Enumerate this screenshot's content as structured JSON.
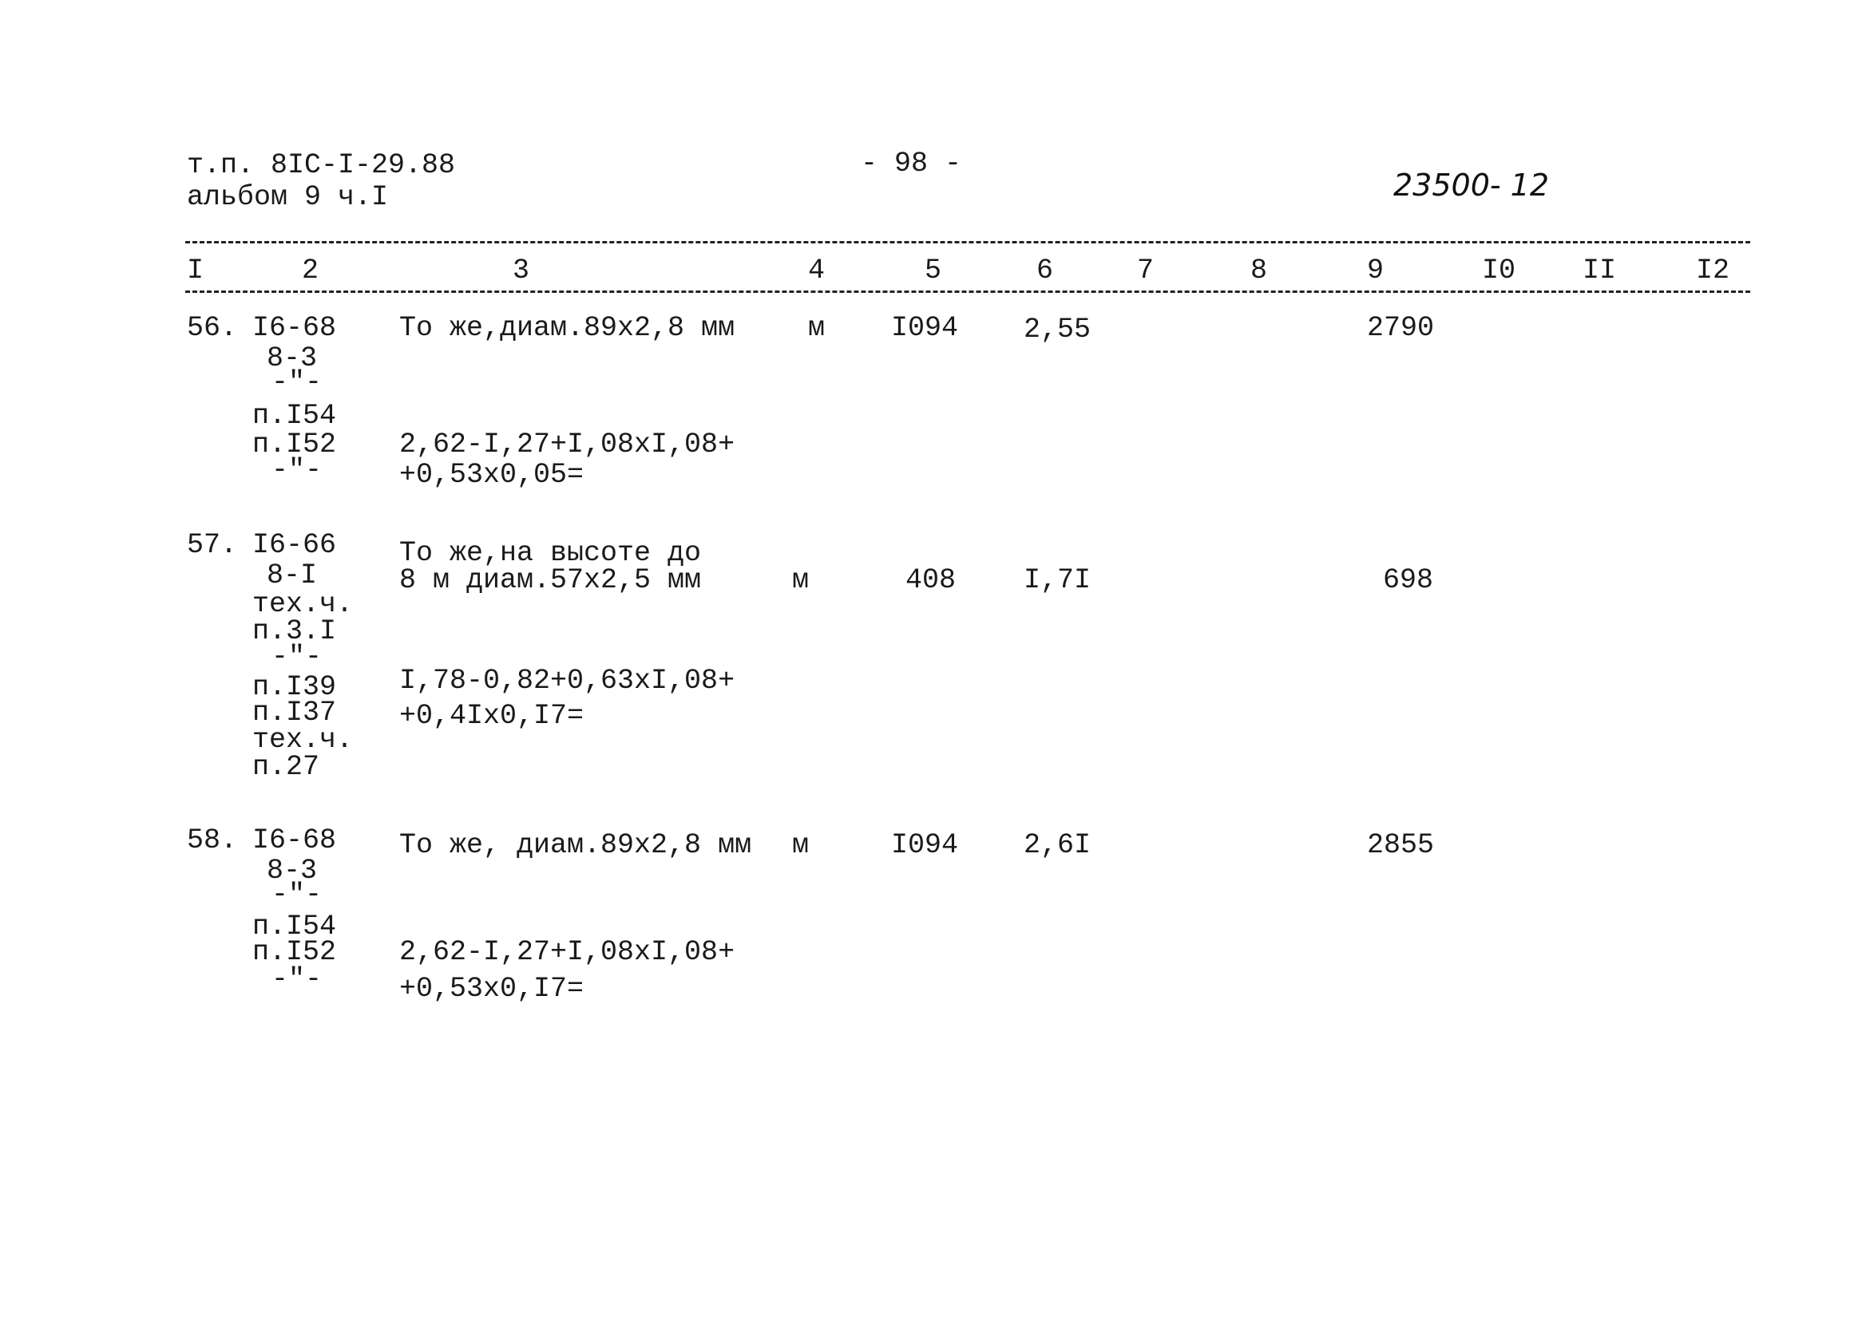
{
  "header": {
    "doc_ref": "т.п. 8IC-I-29.88",
    "album": "альбом 9 ч.I",
    "page_number": "- 98 -",
    "handwritten_code": "23500- 12"
  },
  "table": {
    "columns": [
      "I",
      "2",
      "3",
      "4",
      "5",
      "6",
      "7",
      "8",
      "9",
      "I0",
      "II",
      "I2"
    ],
    "rows": [
      {
        "num": "56.",
        "code_lines": [
          "I6-68",
          "8-3",
          "-\"-",
          "п.I54",
          "п.I52",
          "-\"-"
        ],
        "desc_lines": [
          "То же,диам.89х2,8 мм"
        ],
        "calc_lines": [
          "2,62-I,27+I,08хI,08+",
          "+0,53х0,05="
        ],
        "unit": "м",
        "col5": "I094",
        "col6": "2,55",
        "col9": "2790"
      },
      {
        "num": "57.",
        "code_lines": [
          "I6-66",
          "8-I",
          "тех.ч.",
          "п.3.I",
          "-\"-",
          "п.I39",
          "п.I37",
          "тех.ч.",
          "п.27"
        ],
        "desc_lines": [
          "То же,на высоте до",
          "8 м диам.57х2,5 мм"
        ],
        "calc_lines": [
          "I,78-0,82+0,63хI,08+",
          "+0,4Iх0,I7="
        ],
        "unit": "м",
        "col5": "408",
        "col6": "I,7I",
        "col9": "698"
      },
      {
        "num": "58.",
        "code_lines": [
          "I6-68",
          "8-3",
          "-\"-",
          "п.I54",
          "п.I52",
          "-\"-"
        ],
        "desc_lines": [
          "То же, диам.89х2,8 мм"
        ],
        "calc_lines": [
          "2,62-I,27+I,08хI,08+",
          "+0,53х0,I7="
        ],
        "unit": "м",
        "col5": "I094",
        "col6": "2,6I",
        "col9": "2855"
      }
    ]
  }
}
